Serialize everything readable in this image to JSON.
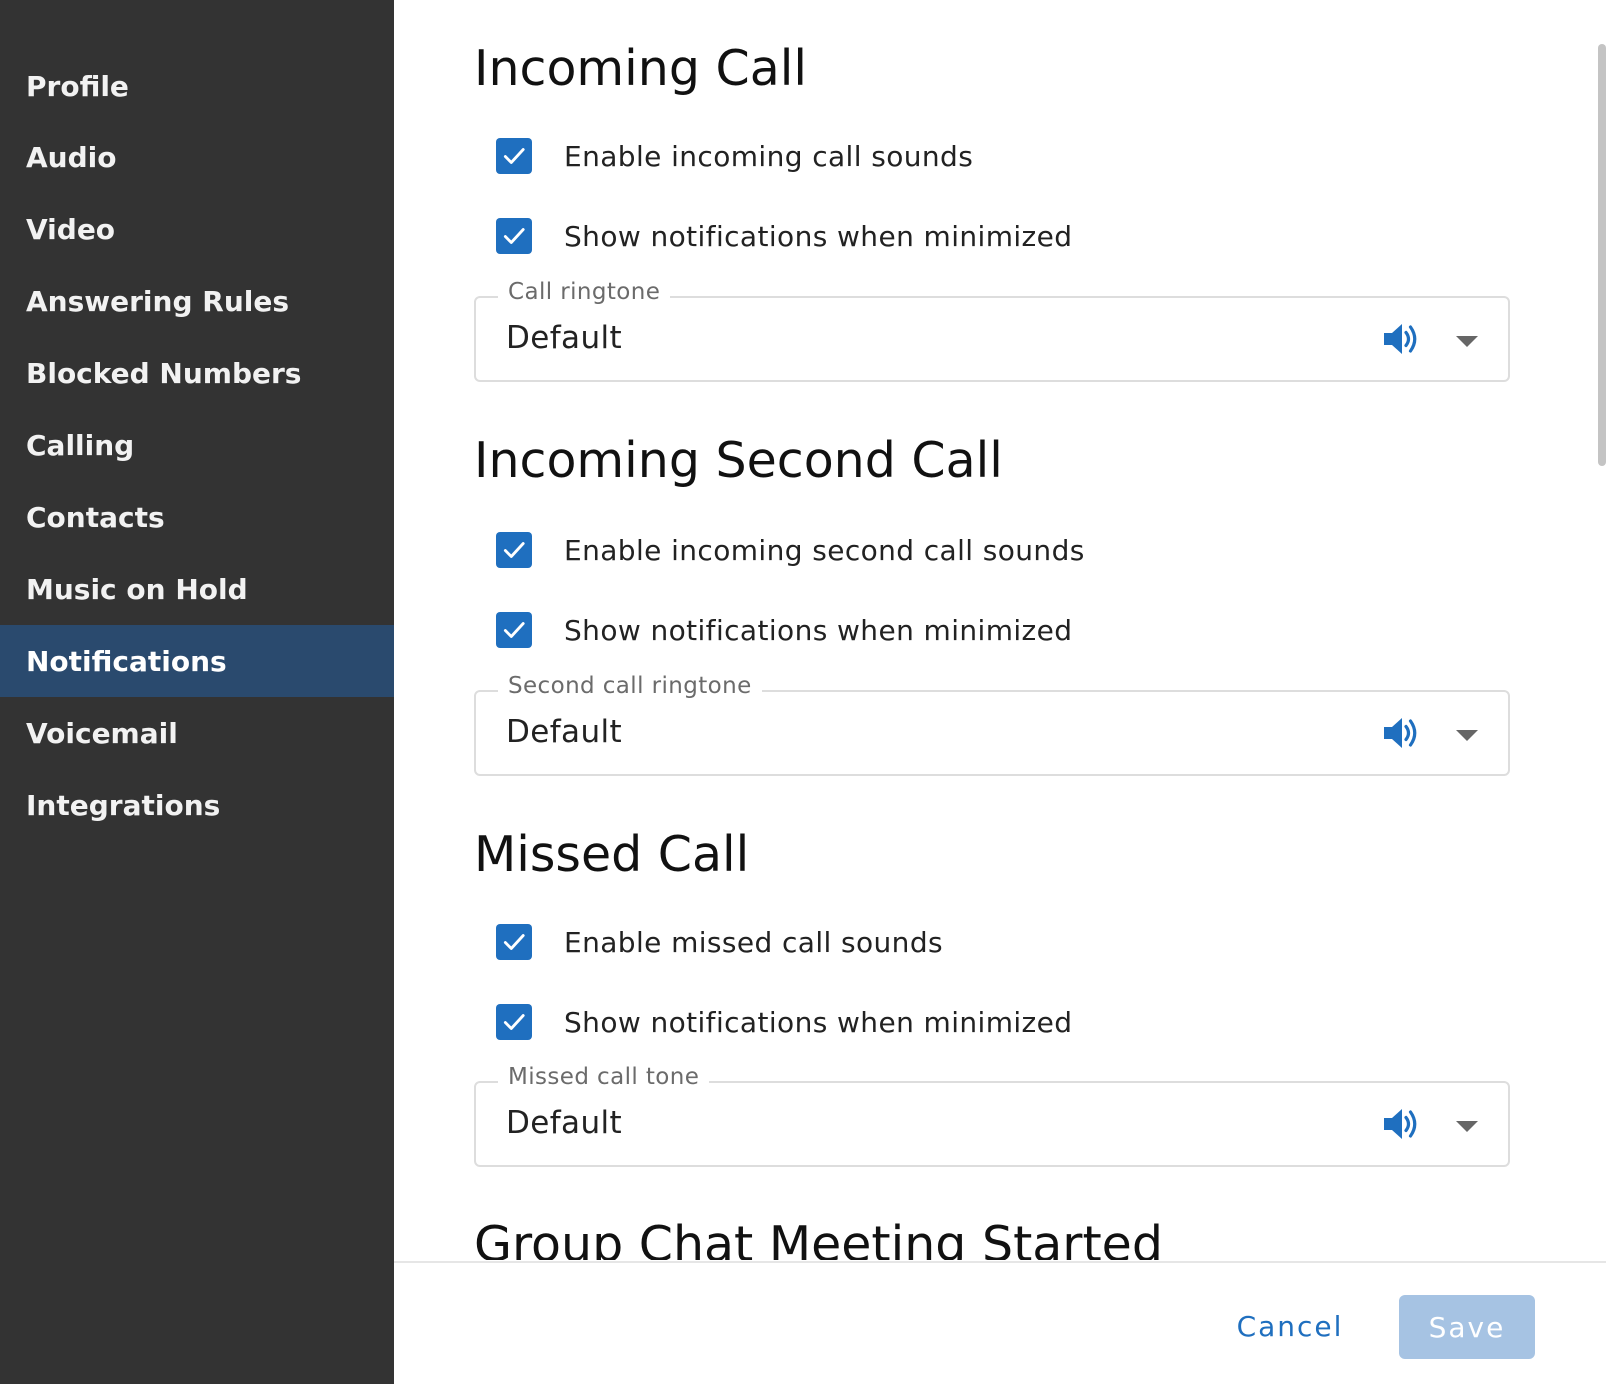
{
  "sidebar": {
    "items": [
      {
        "label": "Profile"
      },
      {
        "label": "Audio"
      },
      {
        "label": "Video"
      },
      {
        "label": "Answering Rules"
      },
      {
        "label": "Blocked Numbers"
      },
      {
        "label": "Calling"
      },
      {
        "label": "Contacts"
      },
      {
        "label": "Music on Hold"
      },
      {
        "label": "Notifications",
        "active": true
      },
      {
        "label": "Voicemail"
      },
      {
        "label": "Integrations"
      }
    ]
  },
  "sections": [
    {
      "title": "Incoming Call",
      "options": [
        {
          "label": "Enable incoming call sounds",
          "checked": true
        },
        {
          "label": "Show notifications when minimized",
          "checked": true
        }
      ],
      "select": {
        "legend": "Call ringtone",
        "value": "Default"
      }
    },
    {
      "title": "Incoming Second Call",
      "options": [
        {
          "label": "Enable incoming second call sounds",
          "checked": true
        },
        {
          "label": "Show notifications when minimized",
          "checked": true
        }
      ],
      "select": {
        "legend": "Second call ringtone",
        "value": "Default"
      }
    },
    {
      "title": "Missed Call",
      "options": [
        {
          "label": "Enable missed call sounds",
          "checked": true
        },
        {
          "label": "Show notifications when minimized",
          "checked": true
        }
      ],
      "select": {
        "legend": "Missed call tone",
        "value": "Default"
      }
    },
    {
      "title": "Group Chat Meeting Started"
    }
  ],
  "footer": {
    "cancel_label": "Cancel",
    "save_label": "Save"
  },
  "icons": {
    "checkbox": "checkmark-icon",
    "preview": "speaker-icon",
    "dropdown": "caret-down-icon"
  },
  "colors": {
    "sidebar_bg": "#333333",
    "sidebar_active": "#2a4a6e",
    "accent": "#1f6fbf",
    "save_disabled": "#a6c3e3"
  }
}
